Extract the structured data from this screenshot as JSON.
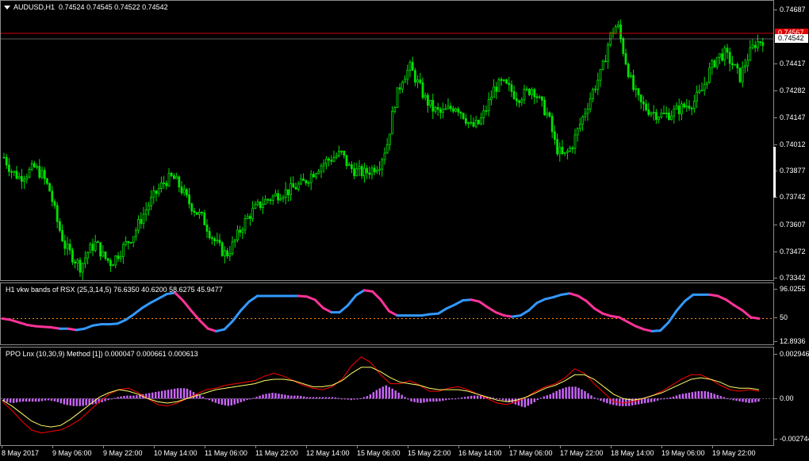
{
  "window": {
    "symbol": "AUDUSD,H1",
    "ohlc": "0.74524 0.74545 0.74522 0.74542"
  },
  "main_axis": {
    "labels": [
      "0.74687",
      "0.74417",
      "0.74282",
      "0.74147",
      "0.74012",
      "0.73877",
      "0.73742",
      "0.73607",
      "0.73472",
      "0.73342"
    ],
    "bid_label": "0.74542",
    "ask_label": "0.74567"
  },
  "rsx_indicator": {
    "title": "H1 vkw bands of RSX (25,3,14,5) 76.6350 40.6200 58.6275 45.9477",
    "axis_labels": [
      "96.0255",
      "50",
      "12.8936"
    ]
  },
  "ppo_indicator": {
    "title": "PPO Lnx (10,30,9) Method [1]) 0.000047 0.000661 0.000613",
    "axis_labels": [
      "0.002946",
      "0.00",
      "-0.002744"
    ]
  },
  "time_axis": {
    "labels": [
      "8 May 2017",
      "9 May 06:00",
      "9 May 22:00",
      "10 May 14:00",
      "11 May 06:00",
      "11 May 22:00",
      "12 May 14:00",
      "15 May 06:00",
      "15 May 22:00",
      "16 May 14:00",
      "17 May 06:00",
      "17 May 22:00",
      "18 May 14:00",
      "19 May 06:00",
      "19 May 22:00"
    ]
  },
  "colors": {
    "candle": "#00e000",
    "bid_line": "#ffffff",
    "ask_line": "#d00000",
    "rsx_up": "#3399ff",
    "rsx_down": "#ff3399",
    "level": "#ff8c00",
    "ppo_hist": "#cc66ff",
    "ppo_fast": "#ff0000",
    "ppo_signal": "#ffff66",
    "zero_line": "#666666"
  },
  "chart_data": [
    {
      "type": "candlestick",
      "symbol": "AUDUSD",
      "timeframe": "H1",
      "ylim": [
        0.73342,
        0.74687
      ],
      "last": {
        "open": 0.74524,
        "high": 0.74545,
        "low": 0.74522,
        "close": 0.74542
      },
      "close_path": [
        0.7395,
        0.7388,
        0.7385,
        0.7387,
        0.739,
        0.7386,
        0.7378,
        0.7362,
        0.735,
        0.7345,
        0.734,
        0.7348,
        0.7352,
        0.7345,
        0.7342,
        0.7347,
        0.7352,
        0.7357,
        0.7365,
        0.7372,
        0.7378,
        0.7383,
        0.7385,
        0.738,
        0.7373,
        0.7368,
        0.7364,
        0.7356,
        0.735,
        0.7346,
        0.7352,
        0.736,
        0.7366,
        0.737,
        0.7373,
        0.7375,
        0.7377,
        0.7378,
        0.738,
        0.7382,
        0.7386,
        0.739,
        0.7393,
        0.7395,
        0.7397,
        0.739,
        0.7388,
        0.7387,
        0.7389,
        0.7392,
        0.7402,
        0.7423,
        0.7435,
        0.744,
        0.7432,
        0.7424,
        0.7419,
        0.7417,
        0.7419,
        0.7421,
        0.7416,
        0.741,
        0.7412,
        0.742,
        0.743,
        0.7432,
        0.7429,
        0.7425,
        0.7427,
        0.743,
        0.7422,
        0.7416,
        0.74,
        0.7395,
        0.74,
        0.741,
        0.742,
        0.743,
        0.7438,
        0.7455,
        0.7462,
        0.7445,
        0.743,
        0.7422,
        0.7419,
        0.7417,
        0.7416,
        0.7417,
        0.7419,
        0.7421,
        0.7423,
        0.7428,
        0.7438,
        0.7445,
        0.7447,
        0.7442,
        0.7435,
        0.7445,
        0.7452,
        0.7454
      ]
    },
    {
      "type": "line",
      "name": "RSX bands",
      "ylim": [
        12.8936,
        96.0255
      ],
      "levels": [
        50
      ],
      "last_values": [
        76.635,
        40.62,
        58.6275,
        45.9477
      ],
      "values": [
        50,
        48,
        44,
        40,
        38,
        37,
        36,
        34,
        34,
        32,
        34,
        39,
        41,
        41,
        42,
        48,
        57,
        67,
        75,
        82,
        89,
        91,
        78,
        62,
        47,
        34,
        30,
        33,
        46,
        63,
        77,
        86,
        86,
        86,
        86,
        86,
        86,
        85,
        80,
        67,
        60,
        60,
        71,
        87,
        95,
        93,
        80,
        62,
        55,
        55,
        55,
        55,
        57,
        58,
        66,
        72,
        79,
        80,
        77,
        68,
        60,
        55,
        53,
        55,
        63,
        75,
        81,
        84,
        88,
        90,
        86,
        78,
        66,
        58,
        54,
        52,
        45,
        38,
        33,
        30,
        31,
        44,
        63,
        78,
        88,
        88,
        88,
        86,
        80,
        71,
        63,
        52,
        50
      ]
    },
    {
      "type": "bar+line",
      "name": "PPO",
      "ylim": [
        -0.002744,
        0.002946
      ],
      "last_values": [
        4.7e-05,
        0.000661,
        0.000613
      ],
      "histogram": [
        -0.0002,
        -0.0003,
        -0.0002,
        -0.0002,
        -0.0002,
        -0.0001,
        -0.0002,
        -0.0004,
        -0.0005,
        -0.0005,
        -0.0004,
        -0.0003,
        -0.0001,
        0.0001,
        0.0002,
        0.0002,
        0.0003,
        0.0004,
        0.0005,
        0.0006,
        0.0007,
        0.0007,
        0.0004,
        0.0001,
        -0.0002,
        -0.0004,
        -0.0005,
        -0.0003,
        -0.0001,
        0.0001,
        0.0003,
        0.0004,
        0.0003,
        0.0002,
        0.0002,
        0.0001,
        0.0001,
        0.0001,
        0.0001,
        0.0,
        -0.0001,
        0.0,
        0.0002,
        0.0006,
        0.0009,
        0.0006,
        0.0002,
        -0.0002,
        -0.0003,
        -0.0002,
        -0.0002,
        -0.0001,
        0.0,
        0.0001,
        0.0002,
        0.0002,
        0.0001,
        0.0,
        -0.0002,
        -0.0004,
        -0.0006,
        -0.0003,
        0.0001,
        0.0003,
        0.0006,
        0.0008,
        0.0008,
        0.0005,
        0.0001,
        -0.0002,
        -0.0004,
        -0.0005,
        -0.0005,
        -0.0004,
        -0.0003,
        -0.0002,
        0.0,
        0.0001,
        0.0003,
        0.0004,
        0.0005,
        0.0005,
        0.0003,
        0.0001,
        -0.0001,
        -0.0002,
        -0.0003,
        -0.0002
      ],
      "fast": [
        -0.0002,
        -0.0008,
        -0.0015,
        -0.0021,
        -0.0023,
        -0.0022,
        -0.0021,
        -0.0018,
        -0.0014,
        -0.0008,
        -0.0002,
        0.0003,
        0.0006,
        0.0007,
        0.0004,
        0.0,
        -0.0004,
        -0.0005,
        -0.0003,
        0.0,
        0.0003,
        0.0006,
        0.0007,
        0.0009,
        0.001,
        0.0011,
        0.0012,
        0.0015,
        0.0017,
        0.0015,
        0.0012,
        0.0009,
        0.0007,
        0.0006,
        0.0008,
        0.0013,
        0.0022,
        0.0028,
        0.0024,
        0.0016,
        0.001,
        0.001,
        0.0012,
        0.0009,
        0.0005,
        0.0005,
        0.0007,
        0.0008,
        0.0006,
        0.0003,
        0.0,
        -0.0003,
        -0.0004,
        -0.0002,
        0.0001,
        0.0005,
        0.0008,
        0.001,
        0.0014,
        0.002,
        0.0017,
        0.001,
        0.0004,
        -0.0002,
        -0.0003,
        -0.0002,
        0.0,
        0.0002,
        0.0005,
        0.0009,
        0.0013,
        0.0016,
        0.0016,
        0.0013,
        0.0009,
        0.0006,
        0.0005,
        0.0006,
        0.0005
      ],
      "signal": [
        -0.0001,
        -0.0005,
        -0.001,
        -0.0015,
        -0.0018,
        -0.0019,
        -0.0018,
        -0.0014,
        -0.0009,
        -0.0004,
        0.0001,
        0.0004,
        0.0006,
        0.0005,
        0.0003,
        0.0,
        -0.0002,
        -0.0003,
        -0.0002,
        0.0,
        0.0002,
        0.0004,
        0.0006,
        0.0007,
        0.0008,
        0.0009,
        0.001,
        0.0012,
        0.0013,
        0.0013,
        0.0012,
        0.001,
        0.0008,
        0.0008,
        0.0009,
        0.0012,
        0.0017,
        0.0021,
        0.0021,
        0.0018,
        0.0014,
        0.0011,
        0.001,
        0.0009,
        0.0007,
        0.0006,
        0.0006,
        0.0006,
        0.0005,
        0.0003,
        0.0001,
        -0.0001,
        -0.0002,
        -0.0001,
        0.0001,
        0.0004,
        0.0007,
        0.0009,
        0.0012,
        0.0016,
        0.0016,
        0.0013,
        0.0008,
        0.0003,
        0.0,
        -0.0001,
        0.0,
        0.0002,
        0.0004,
        0.0007,
        0.001,
        0.0013,
        0.0014,
        0.0013,
        0.0011,
        0.0008,
        0.0007,
        0.0007,
        0.0006
      ]
    }
  ]
}
